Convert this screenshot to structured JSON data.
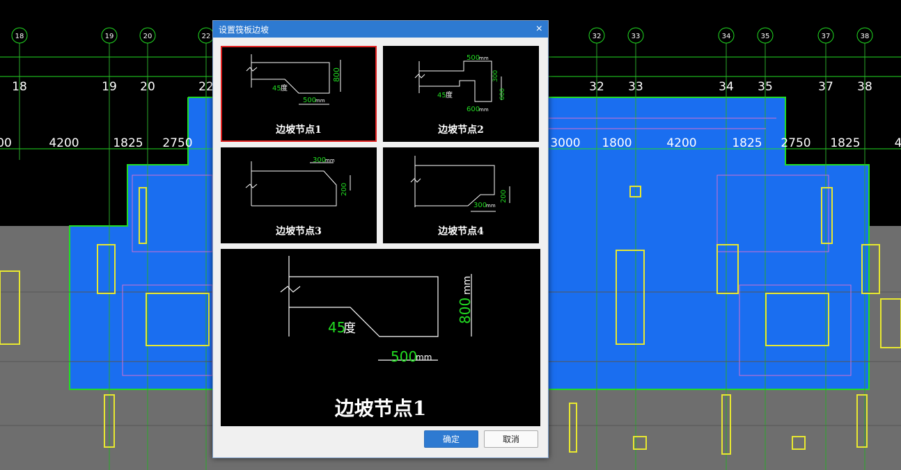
{
  "cad": {
    "axis_numbers_left": [
      "18",
      "19",
      "20",
      "22"
    ],
    "axis_numbers_right": [
      "32",
      "33",
      "34",
      "35",
      "37",
      "38"
    ],
    "dims_left": [
      "00",
      "4200",
      "1825",
      "2750"
    ],
    "dims_right": [
      "3000",
      "1800",
      "4200",
      "1825",
      "2750",
      "1825",
      "4"
    ],
    "colors": {
      "slab": "#1a6ef0",
      "background": "#000000",
      "grid": "#2aaa2a"
    }
  },
  "dialog": {
    "title": "设置筏板边坡",
    "close_glyph": "×",
    "nodes": [
      {
        "label": "边坡节点1",
        "selected": true,
        "angle": "45",
        "angle_unit": "度",
        "width": "500",
        "height": "800",
        "unit": "mm"
      },
      {
        "label": "边坡节点2",
        "selected": false,
        "top_width": "500",
        "angle": "45",
        "angle_unit": "度",
        "h1": "300",
        "h2": "600",
        "bottom_width": "600",
        "unit": "mm"
      },
      {
        "label": "边坡节点3",
        "selected": false,
        "width": "300",
        "height": "200",
        "unit": "mm"
      },
      {
        "label": "边坡节点4",
        "selected": false,
        "width": "300",
        "height": "200",
        "unit": "mm"
      }
    ],
    "preview": {
      "label": "边坡节点1",
      "angle": "45",
      "angle_unit": "度",
      "width": "500",
      "height": "800",
      "unit": "mm"
    },
    "ok_label": "确定",
    "cancel_label": "取消"
  }
}
